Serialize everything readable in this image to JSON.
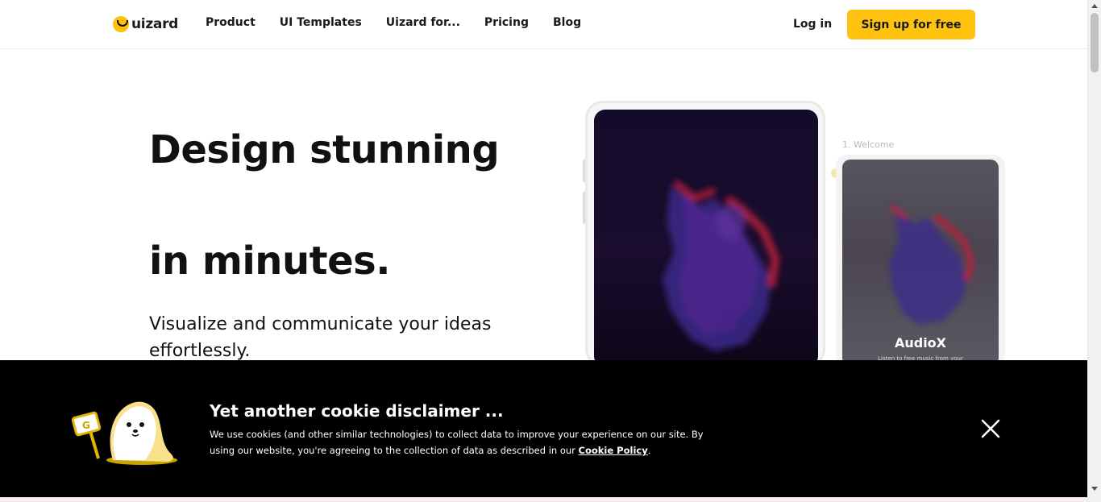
{
  "brand": {
    "name": "uizard",
    "accent": "#FFC20E"
  },
  "nav": {
    "items": [
      "Product",
      "UI Templates",
      "Uizard for...",
      "Pricing",
      "Blog"
    ],
    "login": "Log in",
    "signup": "Sign up for free"
  },
  "hero": {
    "headline_line1": "Design stunning",
    "headline_line2": "in minutes.",
    "subtext": "Visualize and communicate your ideas effortlessly."
  },
  "mockup": {
    "welcome_label": "1. Welcome",
    "app_title": "AudioX",
    "app_subtitle": "Listen to free music from your"
  },
  "cookie": {
    "title": "Yet another cookie disclaimer ...",
    "text": "We use cookies (and other similar technologies) to collect data to improve your experience on our site. By using our website, you're agreeing to the collection of data as described in our ",
    "link": "Cookie Policy",
    "suffix": ".",
    "mascot_sign": "G",
    "close_icon": "close-icon"
  }
}
